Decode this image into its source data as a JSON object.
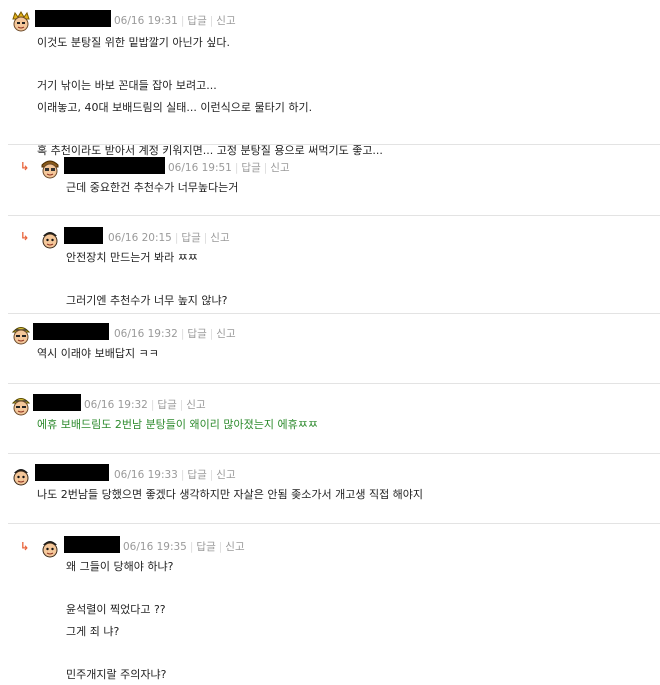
{
  "comments": [
    {
      "time": "06/16 19:31",
      "reply": "답글",
      "report": "신고",
      "lines": [
        "이것도 분탕질 위한 밑밥깔기 아닌가 싶다.",
        "",
        "거기 낚이는 바보 꼰대들 잡아 보려고...",
        "이래놓고, 40대 보배드림의 실태... 이런식으로 물타기 하기.",
        "",
        "혹 추천이라도 받아서 계정 키워지면... 고정 분탕질 용으로 써먹기도 좋고..."
      ]
    },
    {
      "time": "06/16 19:51",
      "reply": "답글",
      "report": "신고",
      "lines": [
        "근데 중요한건 추천수가 너무높다는거"
      ]
    },
    {
      "time": "06/16 20:15",
      "reply": "답글",
      "report": "신고",
      "lines": [
        "안전장치 만드는거 봐라 ㅉㅉ",
        "",
        "그러기엔 추천수가 너무 높지 않냐?"
      ]
    },
    {
      "time": "06/16 19:32",
      "reply": "답글",
      "report": "신고",
      "lines": [
        "역시 이래야 보배답지 ㅋㅋ"
      ]
    },
    {
      "time": "06/16 19:32",
      "reply": "답글",
      "report": "신고",
      "lines": [
        "에휴 보배드림도 2번남 분탕들이 왜이리 많아졌는지 에휴ㅉㅉ"
      ]
    },
    {
      "time": "06/16 19:33",
      "reply": "답글",
      "report": "신고",
      "lines": [
        "나도 2번남들 당했으면 좋겠다 생각하지만 자살은 안됨 좆소가서 개고생 직접 해야지"
      ]
    },
    {
      "time": "06/16 19:35",
      "reply": "답글",
      "report": "신고",
      "lines": [
        "왜 그들이 당해야 하냐?",
        "",
        "윤석렬이 찍었다고 ??",
        "그게 죄 냐?",
        "",
        "민주개지랄 주의자냐?"
      ]
    }
  ],
  "reply_arrow": "↳",
  "colors": {
    "reply_arrow": "#e8633a",
    "meta": "#9a9a9a",
    "green_text": "#2e8b2e"
  },
  "icons": [
    "level-badge-avatar-gold-icon",
    "level-badge-avatar-brown-icon",
    "level-badge-avatar-black-icon",
    "level-badge-avatar-striped-icon"
  ]
}
